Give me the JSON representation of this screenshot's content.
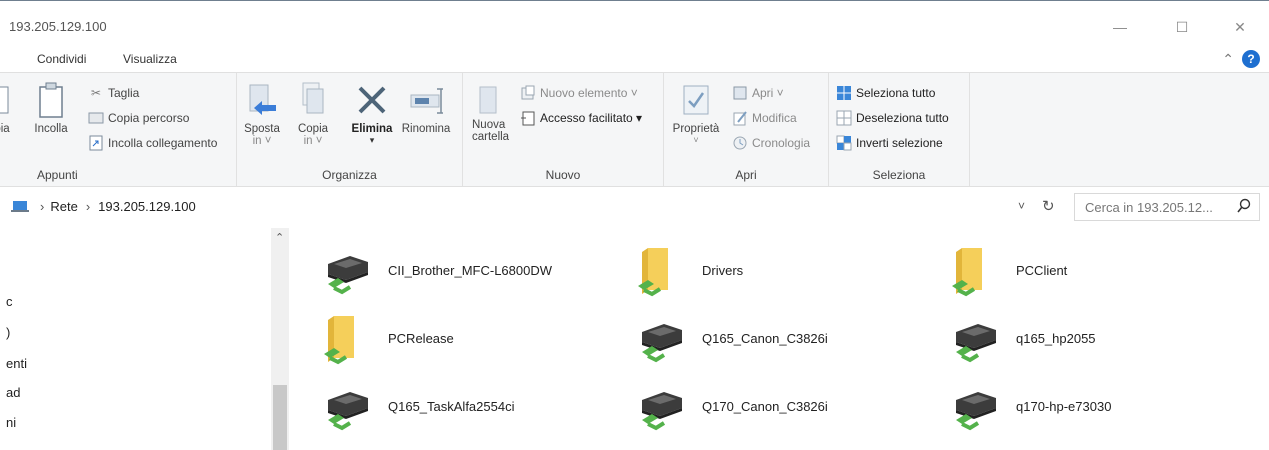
{
  "window": {
    "title": "193.205.129.100",
    "minimize": "—",
    "maximize": "☐",
    "close": "✕"
  },
  "tabs": [
    "Condividi",
    "Visualizza"
  ],
  "ribbon": {
    "appunti": {
      "label": "Appunti",
      "copia": "pia",
      "incolla": "Incolla",
      "taglia": "Taglia",
      "copia_percorso": "Copia percorso",
      "incolla_collegamento": "Incolla collegamento"
    },
    "organizza": {
      "label": "Organizza",
      "sposta_in": [
        "Sposta",
        "in ˅"
      ],
      "copia_in": [
        "Copia",
        "in ˅"
      ],
      "elimina": "Elimina",
      "rinomina": "Rinomina"
    },
    "nuovo": {
      "label": "Nuovo",
      "nuova_cartella": [
        "Nuova",
        "cartella"
      ],
      "nuovo_elemento": "Nuovo elemento ˅",
      "accesso_facilitato": "Accesso facilitato ▾"
    },
    "apri": {
      "label": "Apri",
      "proprieta": "Proprietà",
      "apri": "Apri ˅",
      "modifica": "Modifica",
      "cronologia": "Cronologia"
    },
    "seleziona": {
      "label": "Seleziona",
      "seleziona_tutto": "Seleziona tutto",
      "deseleziona_tutto": "Deseleziona tutto",
      "inverti_selezione": "Inverti selezione"
    }
  },
  "address": {
    "crumbs": [
      "Rete",
      "193.205.129.100"
    ],
    "search_placeholder": "Cerca in 193.205.12..."
  },
  "nav": {
    "items": [
      "c",
      ")",
      "enti",
      "ad",
      "ni"
    ]
  },
  "items": [
    {
      "name": "CII_Brother_MFC-L6800DW",
      "type": "printer"
    },
    {
      "name": "Drivers",
      "type": "folder"
    },
    {
      "name": "PCClient",
      "type": "folder"
    },
    {
      "name": "PCRelease",
      "type": "folder"
    },
    {
      "name": "Q165_Canon_C3826i",
      "type": "printer"
    },
    {
      "name": "q165_hp2055",
      "type": "printer"
    },
    {
      "name": "Q165_TaskAlfa2554ci",
      "type": "printer"
    },
    {
      "name": "Q170_Canon_C3826i",
      "type": "printer"
    },
    {
      "name": "q170-hp-e73030",
      "type": "printer"
    }
  ]
}
